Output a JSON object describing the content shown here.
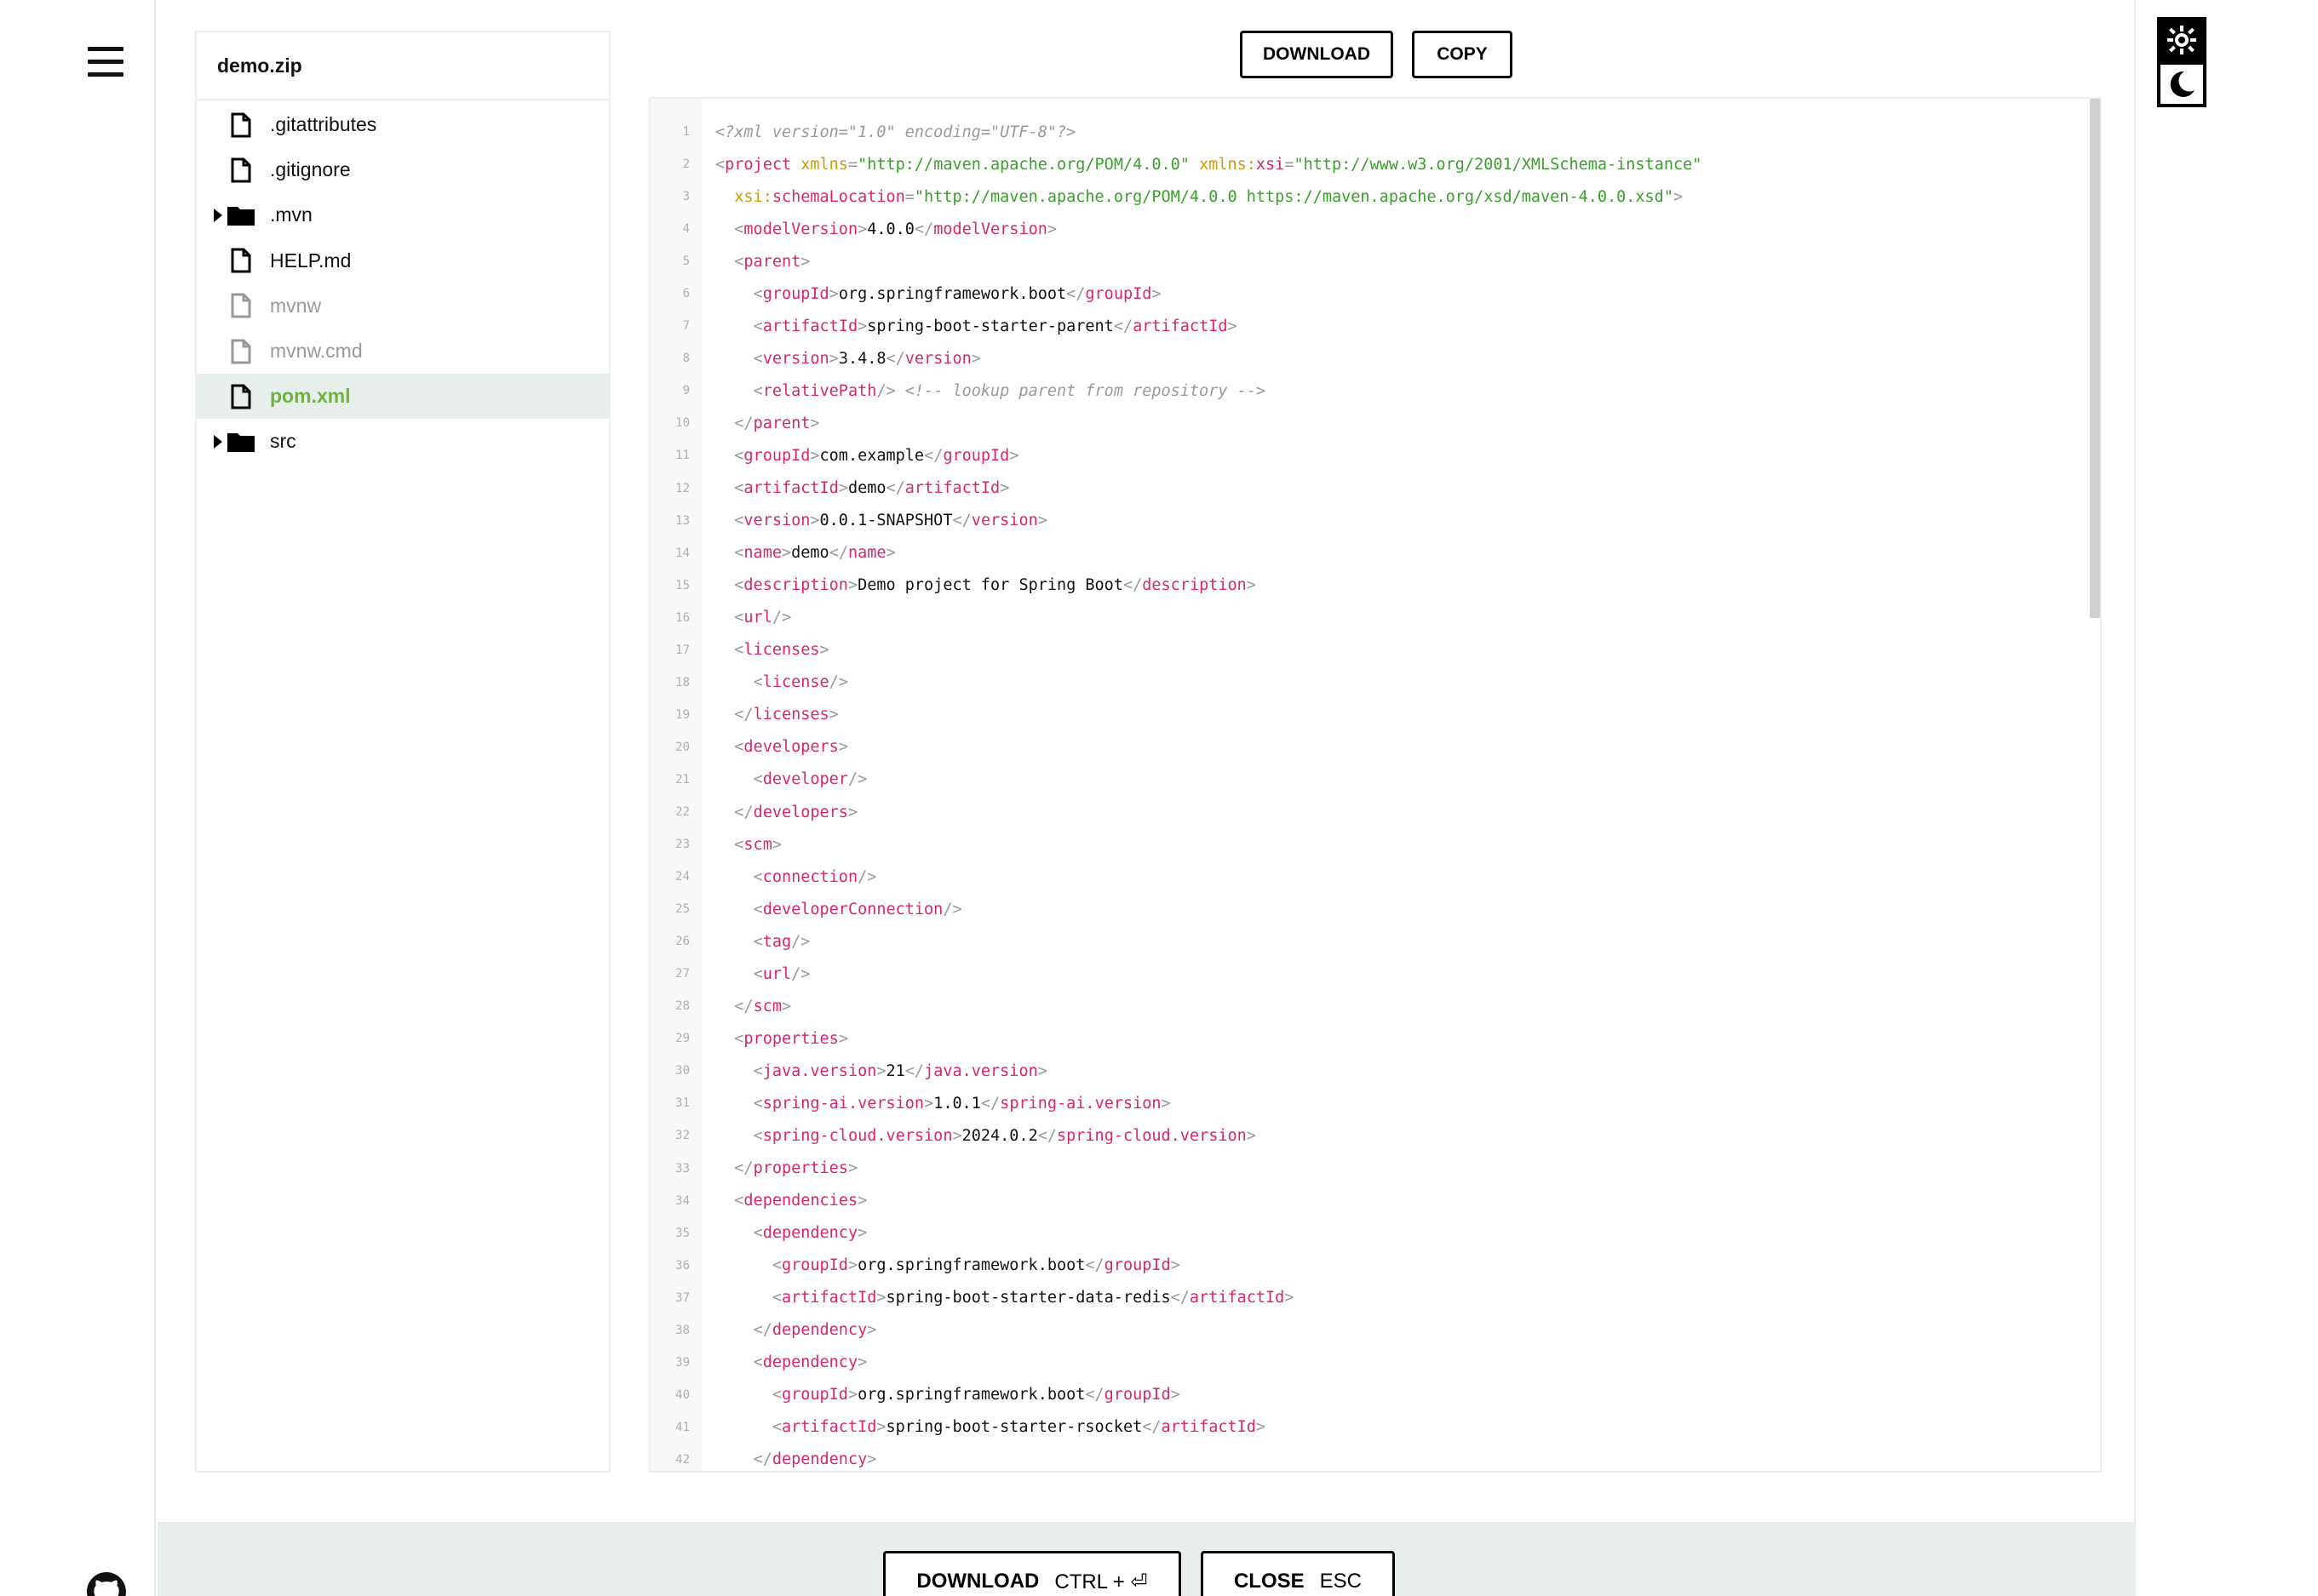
{
  "tree": {
    "title": "demo.zip",
    "items": [
      {
        "label": ".gitattributes",
        "kind": "file",
        "state": "normal"
      },
      {
        "label": ".gitignore",
        "kind": "file",
        "state": "normal"
      },
      {
        "label": ".mvn",
        "kind": "folder",
        "state": "normal"
      },
      {
        "label": "HELP.md",
        "kind": "file",
        "state": "normal"
      },
      {
        "label": "mvnw",
        "kind": "file",
        "state": "muted"
      },
      {
        "label": "mvnw.cmd",
        "kind": "file",
        "state": "muted"
      },
      {
        "label": "pom.xml",
        "kind": "file",
        "state": "active"
      },
      {
        "label": "src",
        "kind": "folder",
        "state": "normal"
      }
    ]
  },
  "toolbar": {
    "download_label": "DOWNLOAD",
    "copy_label": "COPY"
  },
  "bottom": {
    "download_label": "DOWNLOAD",
    "download_shortcut": "CTRL + ⏎",
    "close_label": "CLOSE",
    "close_shortcut": "ESC"
  },
  "icons": {
    "menu": "hamburger-icon",
    "github": "github-icon",
    "light": "sun-icon",
    "dark": "moon-icon"
  },
  "colors": {
    "accent": "#6db33f",
    "tag": "#d8266f",
    "string": "#3a9f2c",
    "attribute": "#d09a0c",
    "comment": "#999999"
  },
  "code": {
    "lines": [
      [
        [
          "c",
          "<?xml version=\"1.0\" encoding=\"UTF-8\"?>"
        ]
      ],
      [
        [
          "p",
          "<"
        ],
        [
          "t",
          "project"
        ],
        [
          "n",
          " "
        ],
        [
          "a",
          "xmlns"
        ],
        [
          "p",
          "="
        ],
        [
          "s",
          "\"http://maven.apache.org/POM/4.0.0\""
        ],
        [
          "n",
          " "
        ],
        [
          "a",
          "xmlns:"
        ],
        [
          "t",
          "xsi"
        ],
        [
          "p",
          "="
        ],
        [
          "s",
          "\"http://www.w3.org/2001/XMLSchema-instance\""
        ]
      ],
      [
        [
          "n",
          "  "
        ],
        [
          "a",
          "xsi:"
        ],
        [
          "t",
          "schemaLocation"
        ],
        [
          "p",
          "="
        ],
        [
          "s",
          "\"http://maven.apache.org/POM/4.0.0 https://maven.apache.org/xsd/maven-4.0.0.xsd\""
        ],
        [
          "p",
          ">"
        ]
      ],
      [
        [
          "n",
          "  "
        ],
        [
          "p",
          "<"
        ],
        [
          "t",
          "modelVersion"
        ],
        [
          "p",
          ">"
        ],
        [
          "n",
          "4.0.0"
        ],
        [
          "p",
          "</"
        ],
        [
          "t",
          "modelVersion"
        ],
        [
          "p",
          ">"
        ]
      ],
      [
        [
          "n",
          "  "
        ],
        [
          "p",
          "<"
        ],
        [
          "t",
          "parent"
        ],
        [
          "p",
          ">"
        ]
      ],
      [
        [
          "n",
          "    "
        ],
        [
          "p",
          "<"
        ],
        [
          "t",
          "groupId"
        ],
        [
          "p",
          ">"
        ],
        [
          "n",
          "org.springframework.boot"
        ],
        [
          "p",
          "</"
        ],
        [
          "t",
          "groupId"
        ],
        [
          "p",
          ">"
        ]
      ],
      [
        [
          "n",
          "    "
        ],
        [
          "p",
          "<"
        ],
        [
          "t",
          "artifactId"
        ],
        [
          "p",
          ">"
        ],
        [
          "n",
          "spring-boot-starter-parent"
        ],
        [
          "p",
          "</"
        ],
        [
          "t",
          "artifactId"
        ],
        [
          "p",
          ">"
        ]
      ],
      [
        [
          "n",
          "    "
        ],
        [
          "p",
          "<"
        ],
        [
          "t",
          "version"
        ],
        [
          "p",
          ">"
        ],
        [
          "n",
          "3.4.8"
        ],
        [
          "p",
          "</"
        ],
        [
          "t",
          "version"
        ],
        [
          "p",
          ">"
        ]
      ],
      [
        [
          "n",
          "    "
        ],
        [
          "p",
          "<"
        ],
        [
          "t",
          "relativePath"
        ],
        [
          "p",
          "/>"
        ],
        [
          "n",
          " "
        ],
        [
          "c",
          "<!-- lookup parent from repository -->"
        ]
      ],
      [
        [
          "n",
          "  "
        ],
        [
          "p",
          "</"
        ],
        [
          "t",
          "parent"
        ],
        [
          "p",
          ">"
        ]
      ],
      [
        [
          "n",
          "  "
        ],
        [
          "p",
          "<"
        ],
        [
          "t",
          "groupId"
        ],
        [
          "p",
          ">"
        ],
        [
          "n",
          "com.example"
        ],
        [
          "p",
          "</"
        ],
        [
          "t",
          "groupId"
        ],
        [
          "p",
          ">"
        ]
      ],
      [
        [
          "n",
          "  "
        ],
        [
          "p",
          "<"
        ],
        [
          "t",
          "artifactId"
        ],
        [
          "p",
          ">"
        ],
        [
          "n",
          "demo"
        ],
        [
          "p",
          "</"
        ],
        [
          "t",
          "artifactId"
        ],
        [
          "p",
          ">"
        ]
      ],
      [
        [
          "n",
          "  "
        ],
        [
          "p",
          "<"
        ],
        [
          "t",
          "version"
        ],
        [
          "p",
          ">"
        ],
        [
          "n",
          "0.0.1-SNAPSHOT"
        ],
        [
          "p",
          "</"
        ],
        [
          "t",
          "version"
        ],
        [
          "p",
          ">"
        ]
      ],
      [
        [
          "n",
          "  "
        ],
        [
          "p",
          "<"
        ],
        [
          "t",
          "name"
        ],
        [
          "p",
          ">"
        ],
        [
          "n",
          "demo"
        ],
        [
          "p",
          "</"
        ],
        [
          "t",
          "name"
        ],
        [
          "p",
          ">"
        ]
      ],
      [
        [
          "n",
          "  "
        ],
        [
          "p",
          "<"
        ],
        [
          "t",
          "description"
        ],
        [
          "p",
          ">"
        ],
        [
          "n",
          "Demo project for Spring Boot"
        ],
        [
          "p",
          "</"
        ],
        [
          "t",
          "description"
        ],
        [
          "p",
          ">"
        ]
      ],
      [
        [
          "n",
          "  "
        ],
        [
          "p",
          "<"
        ],
        [
          "t",
          "url"
        ],
        [
          "p",
          "/>"
        ]
      ],
      [
        [
          "n",
          "  "
        ],
        [
          "p",
          "<"
        ],
        [
          "t",
          "licenses"
        ],
        [
          "p",
          ">"
        ]
      ],
      [
        [
          "n",
          "    "
        ],
        [
          "p",
          "<"
        ],
        [
          "t",
          "license"
        ],
        [
          "p",
          "/>"
        ]
      ],
      [
        [
          "n",
          "  "
        ],
        [
          "p",
          "</"
        ],
        [
          "t",
          "licenses"
        ],
        [
          "p",
          ">"
        ]
      ],
      [
        [
          "n",
          "  "
        ],
        [
          "p",
          "<"
        ],
        [
          "t",
          "developers"
        ],
        [
          "p",
          ">"
        ]
      ],
      [
        [
          "n",
          "    "
        ],
        [
          "p",
          "<"
        ],
        [
          "t",
          "developer"
        ],
        [
          "p",
          "/>"
        ]
      ],
      [
        [
          "n",
          "  "
        ],
        [
          "p",
          "</"
        ],
        [
          "t",
          "developers"
        ],
        [
          "p",
          ">"
        ]
      ],
      [
        [
          "n",
          "  "
        ],
        [
          "p",
          "<"
        ],
        [
          "t",
          "scm"
        ],
        [
          "p",
          ">"
        ]
      ],
      [
        [
          "n",
          "    "
        ],
        [
          "p",
          "<"
        ],
        [
          "t",
          "connection"
        ],
        [
          "p",
          "/>"
        ]
      ],
      [
        [
          "n",
          "    "
        ],
        [
          "p",
          "<"
        ],
        [
          "t",
          "developerConnection"
        ],
        [
          "p",
          "/>"
        ]
      ],
      [
        [
          "n",
          "    "
        ],
        [
          "p",
          "<"
        ],
        [
          "t",
          "tag"
        ],
        [
          "p",
          "/>"
        ]
      ],
      [
        [
          "n",
          "    "
        ],
        [
          "p",
          "<"
        ],
        [
          "t",
          "url"
        ],
        [
          "p",
          "/>"
        ]
      ],
      [
        [
          "n",
          "  "
        ],
        [
          "p",
          "</"
        ],
        [
          "t",
          "scm"
        ],
        [
          "p",
          ">"
        ]
      ],
      [
        [
          "n",
          "  "
        ],
        [
          "p",
          "<"
        ],
        [
          "t",
          "properties"
        ],
        [
          "p",
          ">"
        ]
      ],
      [
        [
          "n",
          "    "
        ],
        [
          "p",
          "<"
        ],
        [
          "t",
          "java.version"
        ],
        [
          "p",
          ">"
        ],
        [
          "n",
          "21"
        ],
        [
          "p",
          "</"
        ],
        [
          "t",
          "java.version"
        ],
        [
          "p",
          ">"
        ]
      ],
      [
        [
          "n",
          "    "
        ],
        [
          "p",
          "<"
        ],
        [
          "t",
          "spring-ai.version"
        ],
        [
          "p",
          ">"
        ],
        [
          "n",
          "1.0.1"
        ],
        [
          "p",
          "</"
        ],
        [
          "t",
          "spring-ai.version"
        ],
        [
          "p",
          ">"
        ]
      ],
      [
        [
          "n",
          "    "
        ],
        [
          "p",
          "<"
        ],
        [
          "t",
          "spring-cloud.version"
        ],
        [
          "p",
          ">"
        ],
        [
          "n",
          "2024.0.2"
        ],
        [
          "p",
          "</"
        ],
        [
          "t",
          "spring-cloud.version"
        ],
        [
          "p",
          ">"
        ]
      ],
      [
        [
          "n",
          "  "
        ],
        [
          "p",
          "</"
        ],
        [
          "t",
          "properties"
        ],
        [
          "p",
          ">"
        ]
      ],
      [
        [
          "n",
          "  "
        ],
        [
          "p",
          "<"
        ],
        [
          "t",
          "dependencies"
        ],
        [
          "p",
          ">"
        ]
      ],
      [
        [
          "n",
          "    "
        ],
        [
          "p",
          "<"
        ],
        [
          "t",
          "dependency"
        ],
        [
          "p",
          ">"
        ]
      ],
      [
        [
          "n",
          "      "
        ],
        [
          "p",
          "<"
        ],
        [
          "t",
          "groupId"
        ],
        [
          "p",
          ">"
        ],
        [
          "n",
          "org.springframework.boot"
        ],
        [
          "p",
          "</"
        ],
        [
          "t",
          "groupId"
        ],
        [
          "p",
          ">"
        ]
      ],
      [
        [
          "n",
          "      "
        ],
        [
          "p",
          "<"
        ],
        [
          "t",
          "artifactId"
        ],
        [
          "p",
          ">"
        ],
        [
          "n",
          "spring-boot-starter-data-redis"
        ],
        [
          "p",
          "</"
        ],
        [
          "t",
          "artifactId"
        ],
        [
          "p",
          ">"
        ]
      ],
      [
        [
          "n",
          "    "
        ],
        [
          "p",
          "</"
        ],
        [
          "t",
          "dependency"
        ],
        [
          "p",
          ">"
        ]
      ],
      [
        [
          "n",
          "    "
        ],
        [
          "p",
          "<"
        ],
        [
          "t",
          "dependency"
        ],
        [
          "p",
          ">"
        ]
      ],
      [
        [
          "n",
          "      "
        ],
        [
          "p",
          "<"
        ],
        [
          "t",
          "groupId"
        ],
        [
          "p",
          ">"
        ],
        [
          "n",
          "org.springframework.boot"
        ],
        [
          "p",
          "</"
        ],
        [
          "t",
          "groupId"
        ],
        [
          "p",
          ">"
        ]
      ],
      [
        [
          "n",
          "      "
        ],
        [
          "p",
          "<"
        ],
        [
          "t",
          "artifactId"
        ],
        [
          "p",
          ">"
        ],
        [
          "n",
          "spring-boot-starter-rsocket"
        ],
        [
          "p",
          "</"
        ],
        [
          "t",
          "artifactId"
        ],
        [
          "p",
          ">"
        ]
      ],
      [
        [
          "n",
          "    "
        ],
        [
          "p",
          "</"
        ],
        [
          "t",
          "dependency"
        ],
        [
          "p",
          ">"
        ]
      ]
    ]
  }
}
